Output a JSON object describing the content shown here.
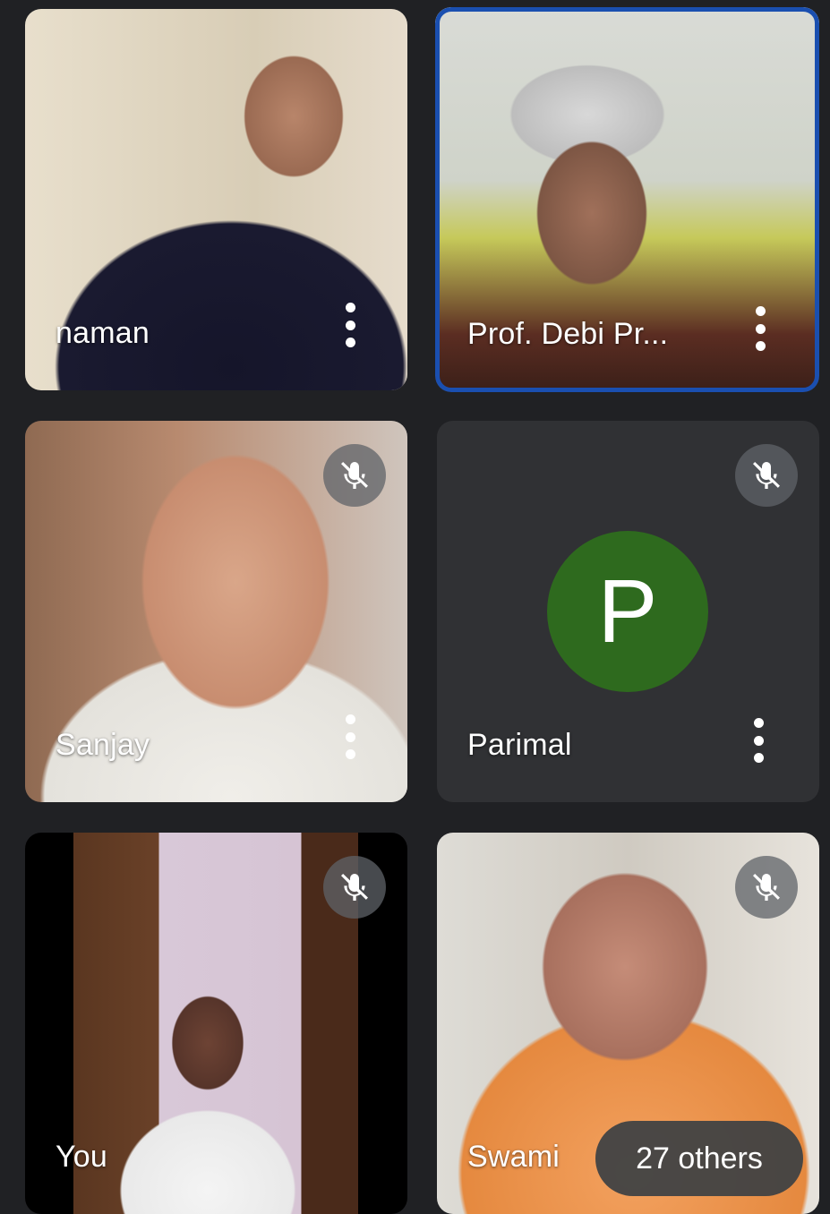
{
  "participants": [
    {
      "name": "naman",
      "muted": false,
      "active": true,
      "video": true
    },
    {
      "name": "Prof. Debi Pr...",
      "muted": false,
      "active": true,
      "video": true
    },
    {
      "name": "Sanjay",
      "muted": true,
      "active": false,
      "video": true
    },
    {
      "name": "Parimal",
      "muted": true,
      "active": false,
      "video": false,
      "avatar_letter": "P"
    },
    {
      "name": "You",
      "muted": true,
      "active": false,
      "video": true
    },
    {
      "name": "Swami",
      "muted": true,
      "active": false,
      "video": true
    }
  ],
  "others": {
    "label": "27 others"
  },
  "colors": {
    "background": "#202124",
    "active_border": "#1a4fb0",
    "avatar_bg": "#2e6a1e"
  },
  "icons": {
    "more": "more-vert-icon",
    "mute": "mic-off-icon"
  }
}
